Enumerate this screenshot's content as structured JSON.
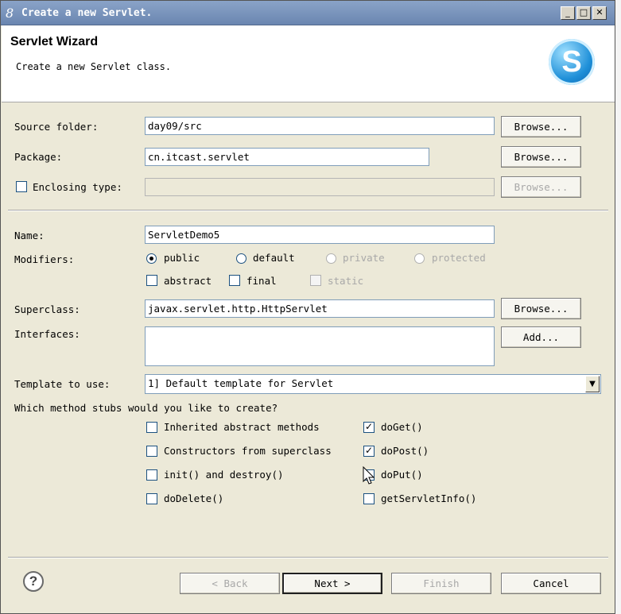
{
  "window": {
    "title": "Create a new Servlet.",
    "icon": "8",
    "controls": {
      "minimize": "_",
      "maximize": "□",
      "close": "✕"
    }
  },
  "banner": {
    "title": "Servlet Wizard",
    "subtitle": "Create a new Servlet class.",
    "logo_letter": "S"
  },
  "form": {
    "source_folder": {
      "label": "Source folder:",
      "value": "day09/src",
      "button": "Browse..."
    },
    "package": {
      "label": "Package:",
      "value": "cn.itcast.servlet",
      "button": "Browse..."
    },
    "enclosing_type": {
      "label": "Enclosing type:",
      "value": "",
      "button": "Browse...",
      "checked": false
    },
    "name": {
      "label": "Name:",
      "value": "ServletDemo5"
    },
    "modifiers": {
      "label": "Modifiers:",
      "radios": [
        {
          "label": "public",
          "selected": true,
          "enabled": true
        },
        {
          "label": "default",
          "selected": false,
          "enabled": true
        },
        {
          "label": "private",
          "selected": false,
          "enabled": false
        },
        {
          "label": "protected",
          "selected": false,
          "enabled": false
        }
      ],
      "checks": [
        {
          "label": "abstract",
          "checked": false,
          "enabled": true
        },
        {
          "label": "final",
          "checked": false,
          "enabled": true
        },
        {
          "label": "static",
          "checked": false,
          "enabled": false
        }
      ]
    },
    "superclass": {
      "label": "Superclass:",
      "value": "javax.servlet.http.HttpServlet",
      "button": "Browse..."
    },
    "interfaces": {
      "label": "Interfaces:",
      "button": "Add..."
    },
    "template": {
      "label": "Template to use:",
      "value": "1] Default template for Servlet"
    },
    "stubs": {
      "question": "Which method stubs would you like to create?",
      "items": [
        {
          "label": "Inherited abstract methods",
          "checked": false
        },
        {
          "label": "doGet()",
          "checked": true
        },
        {
          "label": "Constructors from superclass",
          "checked": false
        },
        {
          "label": "doPost()",
          "checked": true
        },
        {
          "label": "init() and destroy()",
          "checked": false
        },
        {
          "label": "doPut()",
          "checked": false
        },
        {
          "label": "doDelete()",
          "checked": false
        },
        {
          "label": "getServletInfo()",
          "checked": false
        }
      ]
    }
  },
  "footer": {
    "help": "?",
    "back": "< Back",
    "next": "Next >",
    "finish": "Finish",
    "cancel": "Cancel"
  },
  "colors": {
    "title_bar": "#7b96bf",
    "dialog_bg": "#ece9d8",
    "field_border": "#7f9db9",
    "disabled_text": "#a8a8a8"
  }
}
